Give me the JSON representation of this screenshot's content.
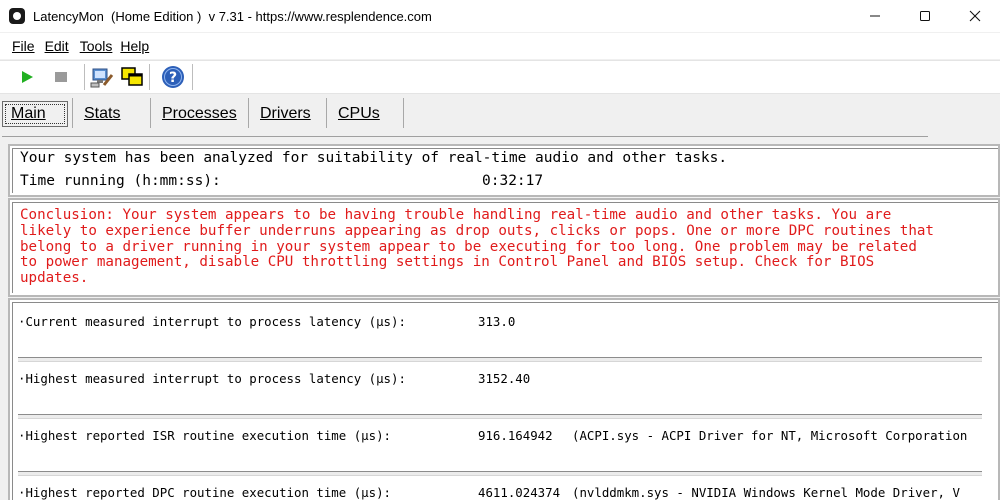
{
  "window": {
    "title": "LatencyMon  (Home Edition )  v 7.31 - https://www.resplendence.com",
    "minimize_icon": "minimize-icon",
    "maximize_icon": "maximize-icon",
    "close_icon": "close-icon"
  },
  "menu": {
    "items": [
      {
        "label": "File"
      },
      {
        "label": "Edit"
      },
      {
        "label": "Tools"
      },
      {
        "label": "Help"
      }
    ]
  },
  "toolbar": {
    "buttons": [
      "play-icon",
      "stop-icon",
      "tools-icon",
      "windows-icon",
      "help-icon"
    ]
  },
  "tabs": [
    {
      "label": "Main",
      "active": true
    },
    {
      "label": "Stats",
      "active": false
    },
    {
      "label": "Processes",
      "active": false
    },
    {
      "label": "Drivers",
      "active": false
    },
    {
      "label": "CPUs",
      "active": false
    }
  ],
  "summary": {
    "analyzed_text": "Your system has been analyzed for suitability of real-time audio and other tasks.",
    "time_label": "Time running (h:mm:ss):",
    "time_value": "0:32:17"
  },
  "conclusion": {
    "text": "Conclusion: Your system appears to be having trouble handling real-time audio and other tasks. You are\nlikely to experience buffer underruns appearing as drop outs, clicks or pops. One or more DPC routines that\nbelong to a driver running in your system appear to be executing for too long. One problem may be related\nto power management, disable CPU throttling settings in Control Panel and BIOS setup. Check for BIOS\nupdates.",
    "color": "#e01b1b"
  },
  "metrics": [
    {
      "label": "·Current measured interrupt to process latency (µs):",
      "value": "313.0",
      "detail": ""
    },
    {
      "label": "·Highest measured interrupt to process latency (µs):",
      "value": "3152.40",
      "detail": ""
    },
    {
      "label": "·Highest reported ISR routine execution time (µs):",
      "value": "916.164942",
      "detail": "(ACPI.sys - ACPI Driver for NT, Microsoft Corporation"
    },
    {
      "label": "·Highest reported DPC routine execution time (µs):",
      "value": "4611.024374",
      "detail": "(nvlddmkm.sys - NVIDIA Windows Kernel Mode Driver, V"
    }
  ]
}
